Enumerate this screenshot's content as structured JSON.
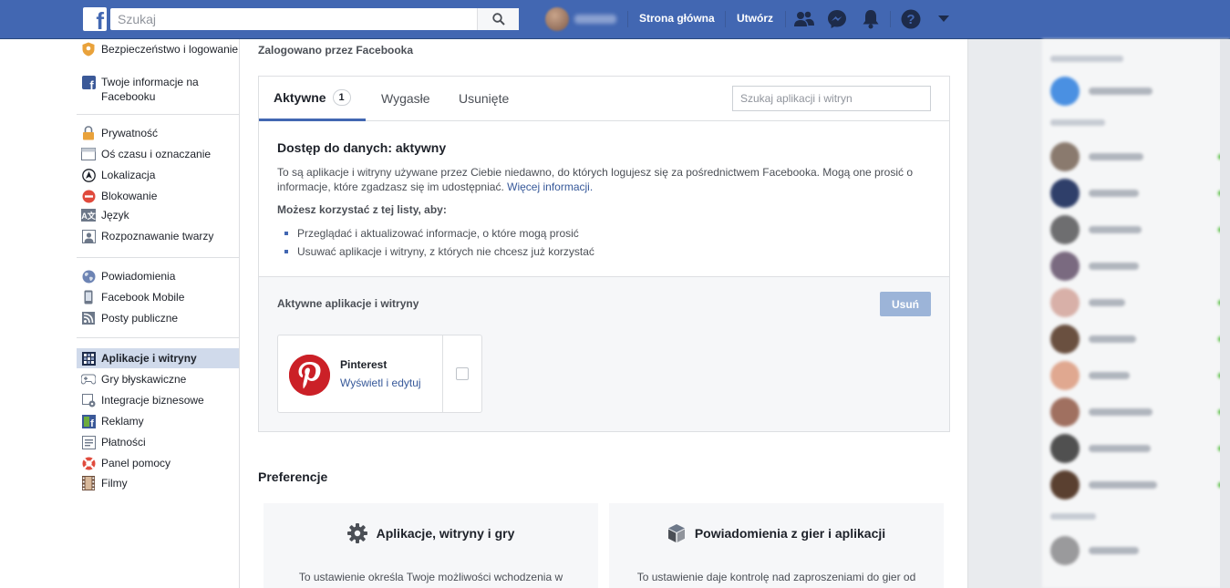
{
  "topbar": {
    "logo": "f",
    "search_placeholder": "Szukaj",
    "user_name": "",
    "home": "Strona główna",
    "create": "Utwórz",
    "icons": [
      "friends-icon",
      "messenger-icon",
      "notifications-icon",
      "help-icon",
      "dropdown-arrow-icon"
    ]
  },
  "sidebar": {
    "group1": [
      {
        "label": "Bezpieczeństwo i logowanie",
        "icon": "shield-icon"
      },
      {
        "label": "Twoje informacje na Facebooku",
        "icon": "facebook-icon"
      }
    ],
    "group2": [
      {
        "label": "Prywatność",
        "icon": "lock-icon"
      },
      {
        "label": "Oś czasu i oznaczanie",
        "icon": "timeline-icon"
      },
      {
        "label": "Lokalizacja",
        "icon": "location-icon"
      },
      {
        "label": "Blokowanie",
        "icon": "block-icon"
      },
      {
        "label": "Język",
        "icon": "language-icon"
      },
      {
        "label": "Rozpoznawanie twarzy",
        "icon": "face-icon"
      }
    ],
    "group3": [
      {
        "label": "Powiadomienia",
        "icon": "globe-icon"
      },
      {
        "label": "Facebook Mobile",
        "icon": "mobile-icon"
      },
      {
        "label": "Posty publiczne",
        "icon": "rss-icon"
      }
    ],
    "group4": [
      {
        "label": "Aplikacje i witryny",
        "icon": "apps-icon",
        "active": true
      },
      {
        "label": "Gry błyskawiczne",
        "icon": "gamepad-icon"
      },
      {
        "label": "Integracje biznesowe",
        "icon": "business-icon"
      },
      {
        "label": "Reklamy",
        "icon": "ads-icon"
      },
      {
        "label": "Płatności",
        "icon": "payments-icon"
      },
      {
        "label": "Panel pomocy",
        "icon": "lifebuoy-icon"
      },
      {
        "label": "Filmy",
        "icon": "film-icon"
      }
    ]
  },
  "main": {
    "logged_title": "Zalogowano przez Facebooka",
    "tabs": [
      {
        "label": "Aktywne",
        "count": "1"
      },
      {
        "label": "Wygasłe"
      },
      {
        "label": "Usunięte"
      }
    ],
    "tab_search_placeholder": "Szukaj aplikacji i witryn",
    "info_title": "Dostęp do danych: aktywny",
    "info_text": "To są aplikacje i witryny używane przez Ciebie niedawno, do których logujesz się za pośrednictwem Facebooka. Mogą one prosić o informacje, które zgadzasz się im udostępniać.",
    "info_link": "Więcej informacji.",
    "may_title": "Możesz korzystać z tej listy, aby:",
    "bullets": [
      "Przeglądać i aktualizować informacje, o które mogą prosić",
      "Usuwać aplikacje i witryny, z których nie chcesz już korzystać"
    ],
    "active_apps_title": "Aktywne aplikacje i witryny",
    "remove_label": "Usuń",
    "app": {
      "name": "Pinterest",
      "edit": "Wyświetl i edytuj",
      "brand_color": "#cb2027"
    },
    "preferences_title": "Preferencje",
    "pref_cards": [
      {
        "title": "Aplikacje, witryny i gry",
        "text": "To ustawienie określa Twoje możliwości wchodzenia w",
        "icon": "gear-icon"
      },
      {
        "title": "Powiadomienia z gier i aplikacji",
        "text": "To ustawienie daje kontrolę nad zaproszeniami do gier od",
        "icon": "box-icon"
      }
    ]
  },
  "colors": {
    "brand": "#4267b2",
    "link": "#365899"
  }
}
